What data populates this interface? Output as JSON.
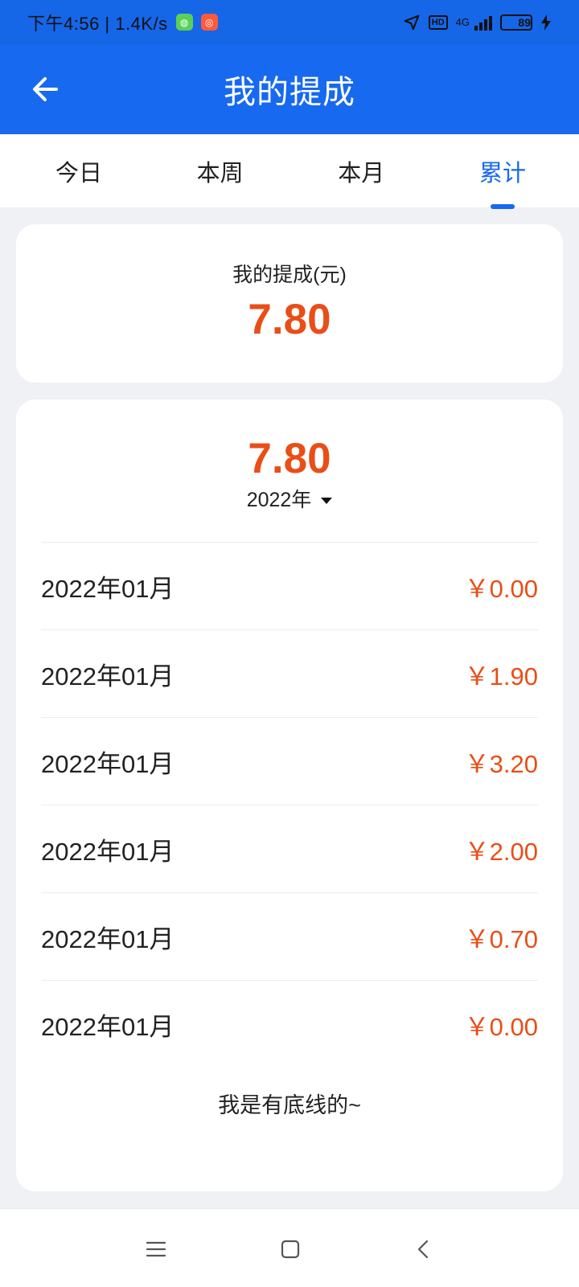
{
  "status_bar": {
    "time_speed": "下午4:56 | 1.4K/s",
    "network": "4G",
    "battery": "89"
  },
  "app_bar": {
    "title": "我的提成"
  },
  "tabs": [
    {
      "label": "今日",
      "active": false
    },
    {
      "label": "本周",
      "active": false
    },
    {
      "label": "本月",
      "active": false
    },
    {
      "label": "累计",
      "active": true
    }
  ],
  "summary": {
    "label": "我的提成(元)",
    "value": "7.80"
  },
  "details": {
    "total": "7.80",
    "year": "2022年",
    "rows": [
      {
        "date": "2022年01月",
        "amount": "￥0.00"
      },
      {
        "date": "2022年01月",
        "amount": "￥1.90"
      },
      {
        "date": "2022年01月",
        "amount": "￥3.20"
      },
      {
        "date": "2022年01月",
        "amount": "￥2.00"
      },
      {
        "date": "2022年01月",
        "amount": "￥0.70"
      },
      {
        "date": "2022年01月",
        "amount": "￥0.00"
      }
    ],
    "footer": "我是有底线的~"
  },
  "colors": {
    "primary": "#1769ef",
    "accent": "#e94e17",
    "background": "#f0f1f5"
  },
  "icons": {
    "back": "arrow-left-icon",
    "location": "navigation-icon",
    "signal": "signal-icon",
    "menu": "menu-icon",
    "home": "square-icon",
    "back_nav": "chevron-left-icon"
  }
}
